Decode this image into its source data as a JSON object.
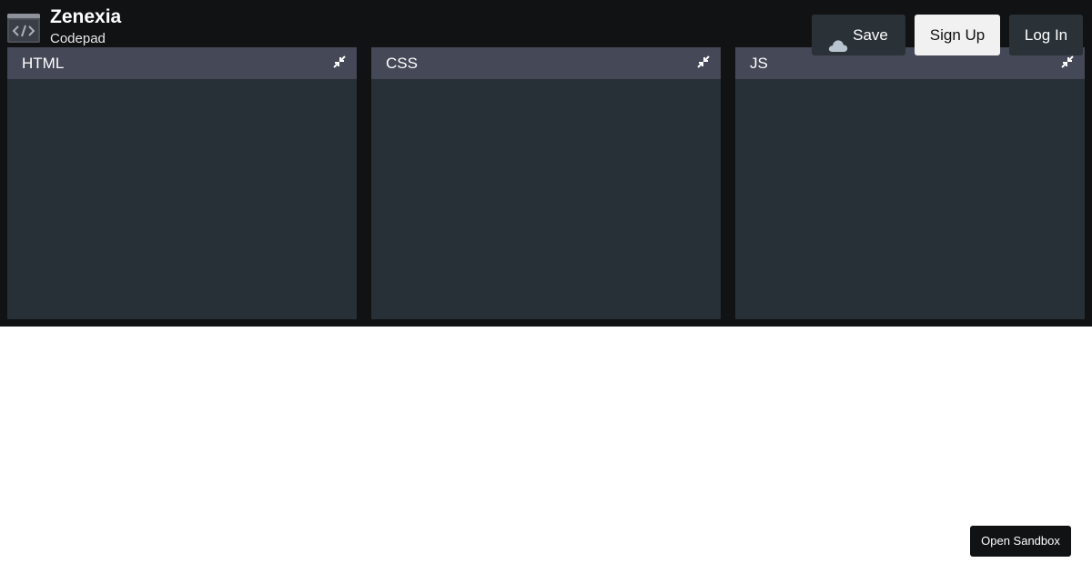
{
  "header": {
    "title": "Zenexia",
    "subtitle": "Codepad",
    "logo_icon": "code-window-icon",
    "buttons": {
      "save": {
        "label": "Save",
        "icon": "cloud-icon"
      },
      "signup": {
        "label": "Sign Up"
      },
      "login": {
        "label": "Log In"
      }
    }
  },
  "panels": [
    {
      "title": "HTML",
      "icon": "collapse-icon"
    },
    {
      "title": "CSS",
      "icon": "collapse-icon"
    },
    {
      "title": "JS",
      "icon": "collapse-icon"
    }
  ],
  "sandbox": {
    "label": "Open Sandbox"
  },
  "colors": {
    "top_background": "#111213",
    "panel_background": "#263036",
    "panel_header": "#444857",
    "button_dark": "#2a3238",
    "button_light": "#f1f1f1"
  }
}
